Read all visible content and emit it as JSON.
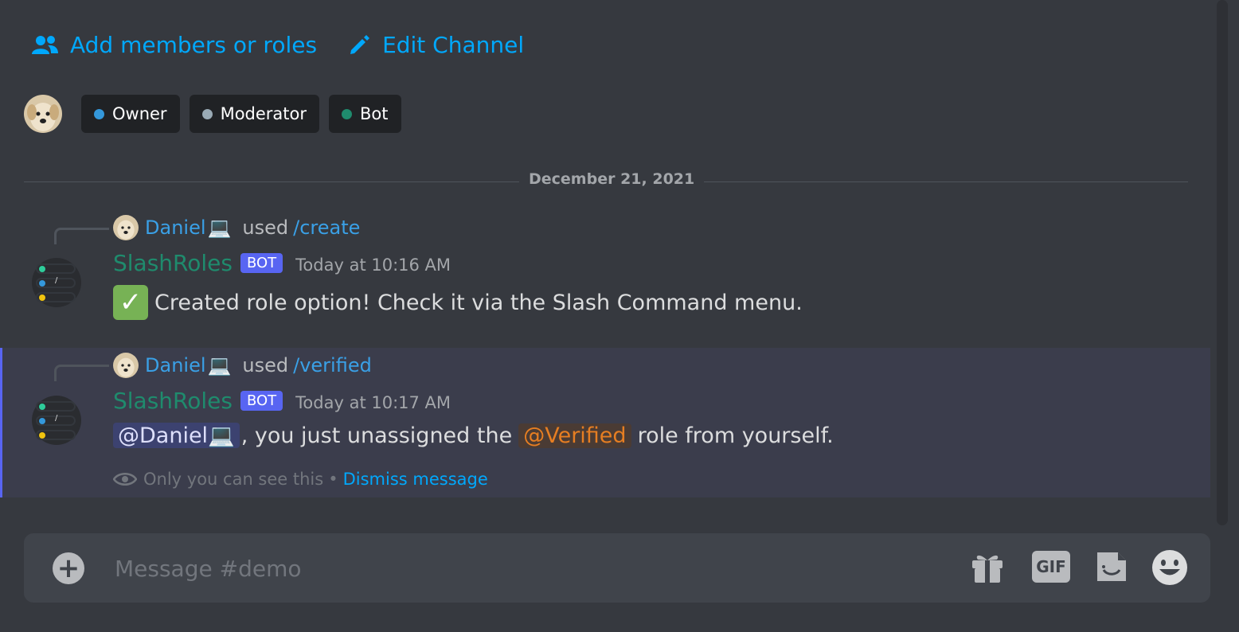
{
  "top_actions": [
    {
      "label": "Add members or roles",
      "icon": "person-add-icon"
    },
    {
      "label": "Edit Channel",
      "icon": "pencil-icon"
    }
  ],
  "roles": [
    {
      "name": "Owner",
      "color": "#3498db"
    },
    {
      "name": "Moderator",
      "color": "#99aab5"
    },
    {
      "name": "Bot",
      "color": "#1f8b6d"
    }
  ],
  "date_divider": "December 21, 2021",
  "messages": [
    {
      "reply_user": "Daniel",
      "reply_emoji": "💻",
      "reply_used": "used",
      "reply_command": "/create",
      "author": "SlashRoles",
      "badge": "BOT",
      "time": "Today at 10:16 AM",
      "text": "Created role option! Check it via the Slash Command menu."
    },
    {
      "reply_user": "Daniel",
      "reply_emoji": "💻",
      "reply_used": "used",
      "reply_command": "/verified",
      "author": "SlashRoles",
      "badge": "BOT",
      "time": "Today at 10:17 AM",
      "mention": "@Daniel💻",
      "text_before": ", you just unassigned the",
      "role_mention": "@Verified",
      "text_after": "role from yourself.",
      "ephemeral_note": "Only you can see this",
      "ephemeral_sep": "•",
      "dismiss": "Dismiss message"
    }
  ],
  "composer": {
    "placeholder": "Message #demo",
    "gif_label": "GIF"
  }
}
